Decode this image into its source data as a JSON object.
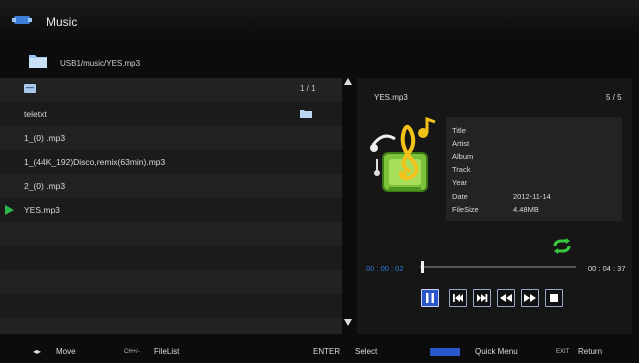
{
  "header": {
    "title": "Music",
    "path": "USB1/music/YES.mp3"
  },
  "list": {
    "page_count": "1 / 1",
    "items": [
      "teletxt",
      "1_(0)       .mp3",
      "1_(44K_192)Disco,remix(63min).mp3",
      "2_(0)       .mp3",
      "YES.mp3"
    ]
  },
  "info": {
    "filename": "YES.mp3",
    "index": "5 / 5",
    "labels": [
      "Title",
      "Artist",
      "Album",
      "Track",
      "Year",
      "Date",
      "FileSize"
    ],
    "date_value": "2012-11-14",
    "filesize_value": "4.48MB"
  },
  "playback": {
    "current_time": "00 : 00 : 02",
    "total_time": "00 : 04 : 37",
    "progress": 0.01
  },
  "footer": {
    "move_key": "◂▸",
    "move_label": "Move",
    "ch_key": "CH+/-",
    "ch_label": "FileList",
    "enter_key": "ENTER",
    "enter_label": "Select",
    "quick_label": "Quick Menu",
    "exit_key": "EXIT",
    "exit_label": "Return"
  },
  "colors": {
    "accent_blue": "#2a56c8",
    "play_marker_green": "#2fb84a",
    "time_blue": "#2b7ad8"
  },
  "icons": {
    "app": "music-app-icon",
    "folder": "folder-icon",
    "art": "music-note-art-icon",
    "repeat": "repeat-icon",
    "controls": [
      "pause-icon",
      "previous-icon",
      "next-icon",
      "rewind-icon",
      "fast-forward-icon",
      "stop-icon"
    ]
  }
}
